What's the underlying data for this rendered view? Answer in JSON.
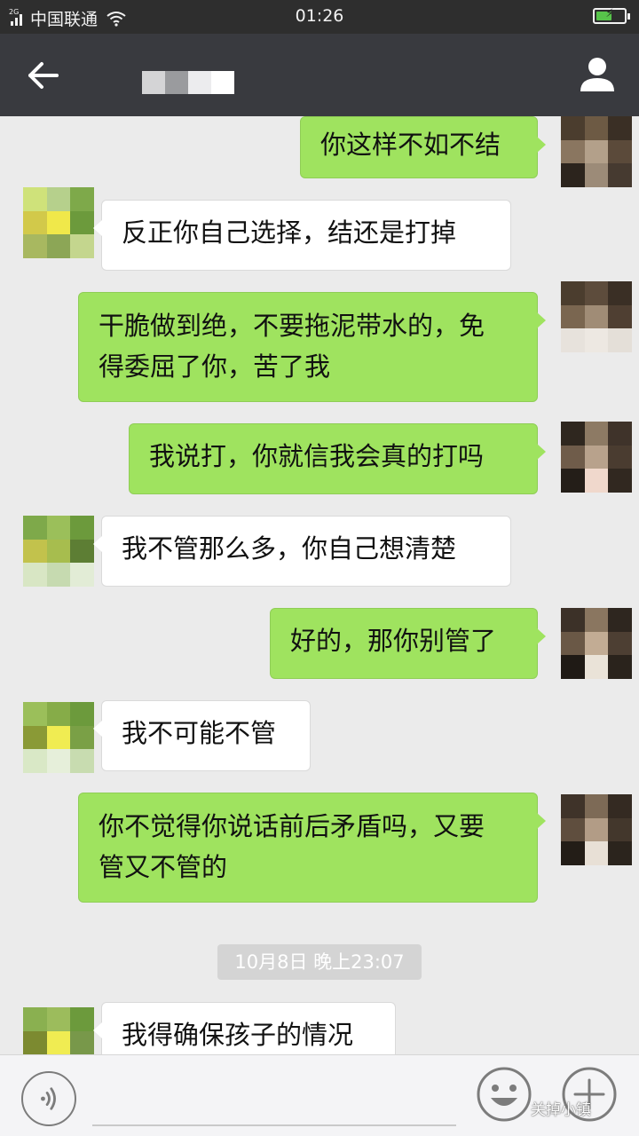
{
  "status_bar": {
    "network_type": "2G",
    "carrier": "中国联通",
    "time": "01:26",
    "battery_level": 0.55,
    "battery_color": "#57c44a"
  },
  "title_bar": {
    "back_icon": "arrow-left-icon",
    "contact_name": "",
    "profile_icon": "person-icon",
    "background": "#393a3f"
  },
  "messages": [
    {
      "side": "me",
      "text": "你这样不如不结"
    },
    {
      "side": "them",
      "text": "反正你自己选择，结还是打掉"
    },
    {
      "side": "me",
      "lines": [
        "干脆做到绝，不要拖泥带水的，免",
        "得委屈了你，苦了我"
      ]
    },
    {
      "side": "me",
      "text": "我说打，你就信我会真的打吗"
    },
    {
      "side": "them",
      "text": "我不管那么多，你自己想清楚"
    },
    {
      "side": "me",
      "text": "好的，那你别管了"
    },
    {
      "side": "them",
      "text": "我不可能不管"
    },
    {
      "side": "me",
      "lines": [
        "你不觉得你说话前后矛盾吗，又要",
        "管又不管的"
      ]
    },
    {
      "side": "them",
      "text": "我得确保孩子的情况"
    }
  ],
  "timestamp": "10月8日 晚上23:07",
  "input_bar": {
    "voice_icon": "voice-icon",
    "emoji_icon": "smiley-icon",
    "plus_icon": "plus-icon"
  },
  "watermark": "关掉小镇",
  "colors": {
    "my_bubble": "#9fe35f",
    "their_bubble": "#ffffff",
    "chat_background": "#ebebeb"
  }
}
